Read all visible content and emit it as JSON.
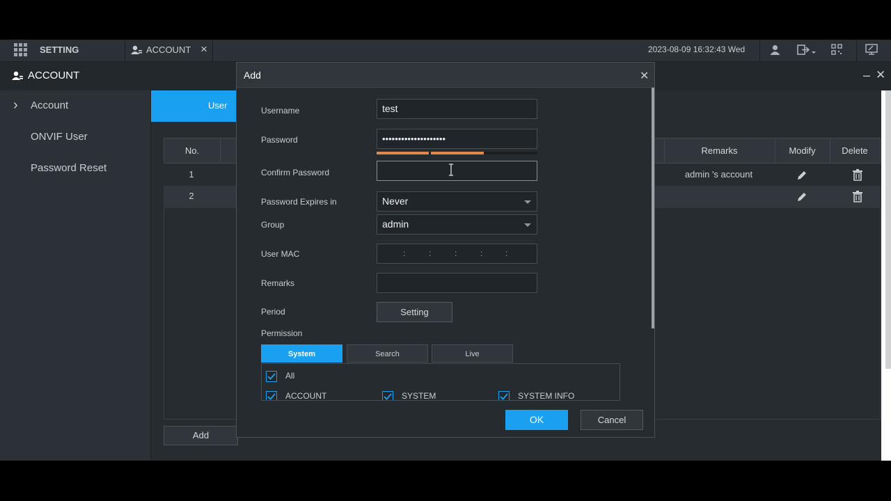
{
  "topbar": {
    "setting_label": "SETTING",
    "account_tab_label": "ACCOUNT",
    "close_glyph": "×",
    "datetime": "2023-08-09 16:32:43 Wed"
  },
  "header": {
    "title": "ACCOUNT",
    "minimize_glyph": "–",
    "close_glyph": "✕"
  },
  "sidebar": {
    "items": [
      {
        "label": "Account",
        "active": true
      },
      {
        "label": "ONVIF User"
      },
      {
        "label": "Password Reset"
      }
    ],
    "chevron": "›"
  },
  "main": {
    "tab_user": "User",
    "columns": {
      "no": "No.",
      "remarks": "Remarks",
      "modify": "Modify",
      "delete": "Delete"
    },
    "rows": [
      {
        "no": "1",
        "remarks": "admin 's account"
      },
      {
        "no": "2",
        "remarks": ""
      }
    ],
    "add_button": "Add"
  },
  "modal": {
    "title": "Add",
    "close_glyph": "✕",
    "username_label": "Username",
    "username_value": "test",
    "password_label": "Password",
    "password_value": "••••••••••••••••••••",
    "confirm_label": "Confirm Password",
    "confirm_value": "",
    "expires_label": "Password Expires in",
    "expires_value": "Never",
    "group_label": "Group",
    "group_value": "admin",
    "mac_label": "User MAC",
    "mac_separators": [
      ":",
      ":",
      ":",
      ":",
      ":"
    ],
    "remarks_label": "Remarks",
    "remarks_value": "",
    "period_label": "Period",
    "period_button": "Setting",
    "permission_label": "Permission",
    "permission_tabs": [
      "System",
      "Search",
      "Live"
    ],
    "perm_all": "All",
    "perm_items": [
      "ACCOUNT",
      "SYSTEM",
      "SYSTEM INFO"
    ],
    "ok_button": "OK",
    "cancel_button": "Cancel"
  },
  "colors": {
    "accent": "#1aa0f0",
    "strength_bar": "#e0894a"
  },
  "icons": [
    "grid-icon",
    "user-icon",
    "logout-icon",
    "qr-icon",
    "monitor-icon",
    "pencil-icon",
    "trash-icon",
    "check-icon"
  ]
}
